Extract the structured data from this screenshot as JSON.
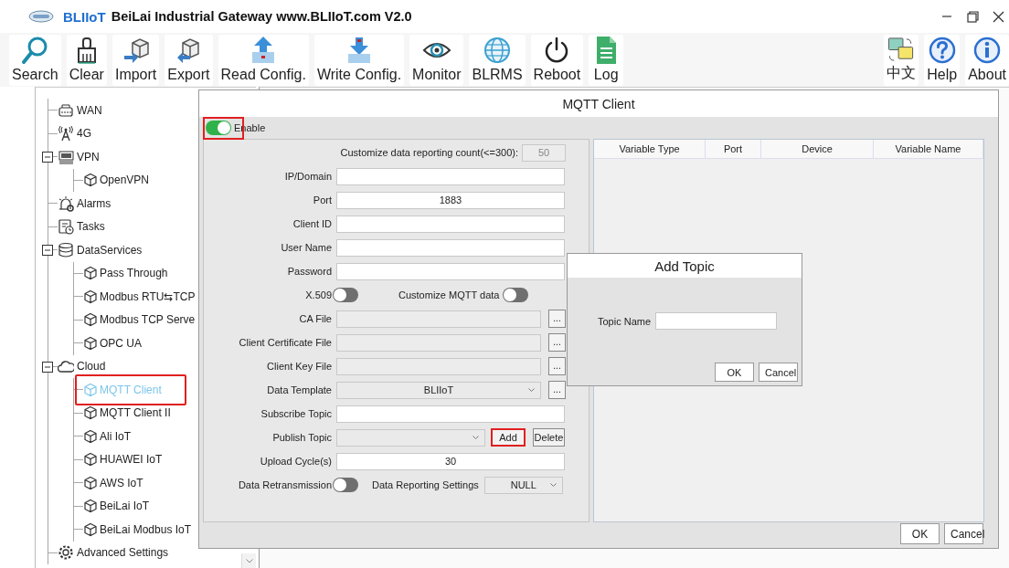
{
  "window": {
    "brand": "BLIIoT",
    "title": "BeiLai Industrial Gateway www.BLIIoT.com V2.0"
  },
  "toolbar": {
    "left": [
      {
        "label": "Search"
      },
      {
        "label": "Clear"
      },
      {
        "label": "Import"
      },
      {
        "label": "Export"
      },
      {
        "label": "Read Config."
      },
      {
        "label": "Write Config."
      },
      {
        "label": "Monitor"
      },
      {
        "label": "BLRMS"
      },
      {
        "label": "Reboot"
      },
      {
        "label": "Log"
      }
    ],
    "right": [
      {
        "label": "中文"
      },
      {
        "label": "Help"
      },
      {
        "label": "About"
      }
    ]
  },
  "tree": {
    "items": [
      {
        "label": "WAN",
        "selected": false,
        "highlighted": false
      },
      {
        "label": "4G",
        "selected": false,
        "highlighted": false
      },
      {
        "label": "VPN",
        "expanded": true,
        "selected": false,
        "highlighted": false,
        "children": [
          {
            "label": "OpenVPN",
            "selected": false,
            "highlighted": false
          }
        ]
      },
      {
        "label": "Alarms",
        "selected": false,
        "highlighted": false
      },
      {
        "label": "Tasks",
        "selected": false,
        "highlighted": false
      },
      {
        "label": "DataServices",
        "expanded": true,
        "selected": false,
        "highlighted": false,
        "children": [
          {
            "label": "Pass Through",
            "selected": false,
            "highlighted": false
          },
          {
            "label": "Modbus RTU⇆TCP",
            "selected": false,
            "highlighted": false
          },
          {
            "label": "Modbus TCP Serve",
            "selected": false,
            "highlighted": false
          },
          {
            "label": "OPC UA",
            "selected": false,
            "highlighted": false
          }
        ]
      },
      {
        "label": "Cloud",
        "expanded": true,
        "selected": false,
        "highlighted": false,
        "children": [
          {
            "label": "MQTT Client",
            "selected": true,
            "highlighted": true
          },
          {
            "label": "MQTT Client II",
            "selected": false,
            "highlighted": false
          },
          {
            "label": "Ali IoT",
            "selected": false,
            "highlighted": false
          },
          {
            "label": "HUAWEI IoT",
            "selected": false,
            "highlighted": false
          },
          {
            "label": "AWS IoT",
            "selected": false,
            "highlighted": false
          },
          {
            "label": "BeiLai IoT",
            "selected": false,
            "highlighted": false
          },
          {
            "label": "BeiLai Modbus IoT",
            "selected": false,
            "highlighted": false
          }
        ]
      },
      {
        "label": "Advanced Settings",
        "selected": false,
        "highlighted": false
      }
    ]
  },
  "mqtt_dialog": {
    "title": "MQTT Client",
    "enable": {
      "label": "Enable",
      "on": true,
      "highlighted": true
    },
    "fields": [
      {
        "kind": "count",
        "label": "Customize data reporting count(<=300):",
        "value": "50",
        "disabled": true
      },
      {
        "kind": "text",
        "label": "IP/Domain",
        "disabled": false
      },
      {
        "kind": "text",
        "label": "Port",
        "value": "1883",
        "disabled": false
      },
      {
        "kind": "text",
        "label": "Client ID",
        "disabled": false
      },
      {
        "kind": "text",
        "label": "User Name",
        "disabled": false
      },
      {
        "kind": "text",
        "label": "Password",
        "disabled": false
      },
      {
        "kind": "switches",
        "items": [
          {
            "label": "X.509",
            "on": false
          },
          {
            "label": "Customize MQTT data",
            "on": false
          }
        ]
      },
      {
        "kind": "file",
        "label": "CA File",
        "button": "...",
        "disabled": true
      },
      {
        "kind": "file",
        "label": "Client Certificate File",
        "button": "...",
        "disabled": true
      },
      {
        "kind": "file",
        "label": "Client Key File",
        "button": "...",
        "disabled": true
      },
      {
        "kind": "select_browse",
        "label": "Data Template",
        "value": "BLIIoT",
        "button": "..."
      },
      {
        "kind": "text",
        "label": "Subscribe Topic",
        "disabled": false
      },
      {
        "kind": "topic",
        "label": "Publish Topic",
        "buttons": [
          {
            "label": "Add",
            "highlighted": true
          },
          {
            "label": "Delete",
            "highlighted": false
          }
        ]
      },
      {
        "kind": "text",
        "label": "Upload Cycle(s)",
        "value": "30",
        "disabled": false
      },
      {
        "kind": "switch_select",
        "label": "Data Retransmission",
        "on": false,
        "select_label": "Data Reporting Settings",
        "value": "NULL"
      }
    ],
    "table": {
      "columns": [
        "Variable Type",
        "Port",
        "Device",
        "Variable Name"
      ]
    },
    "buttons": [
      "OK",
      "Cancel"
    ]
  },
  "add_topic_dialog": {
    "title": "Add Topic",
    "field_label": "Topic Name",
    "buttons": [
      "OK",
      "Cancel"
    ]
  }
}
